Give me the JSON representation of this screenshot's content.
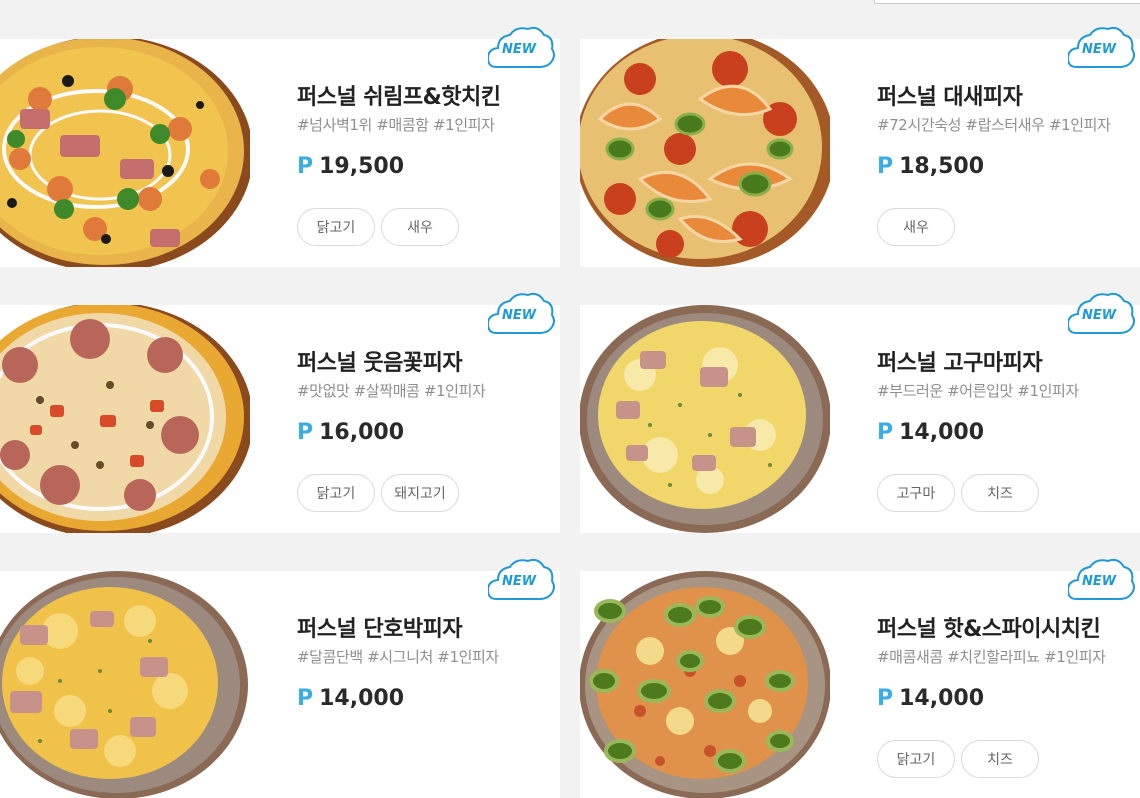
{
  "accent_color": "#3aaee4",
  "badge_color": "#1f9ad6",
  "products": [
    {
      "name": "퍼스널 쉬림프&핫치킨",
      "tags": "#넘사벽1위 #매콤함 #1인피자",
      "currency": "P",
      "price": "19,500",
      "badge": "NEW",
      "image": "shrimp-hot-chicken-pizza",
      "toppings": [
        "닭고기",
        "새우"
      ]
    },
    {
      "name": "퍼스널 대새피자",
      "tags": "#72시간숙성 #랍스터새우 #1인피자",
      "currency": "P",
      "price": "18,500",
      "badge": "NEW",
      "image": "big-shrimp-pizza",
      "toppings": [
        "새우"
      ]
    },
    {
      "name": "퍼스널 웃음꽃피자",
      "tags": "#맛없맛 #살짝매콤 #1인피자",
      "currency": "P",
      "price": "16,000",
      "badge": "NEW",
      "image": "smile-flower-pizza",
      "toppings": [
        "닭고기",
        "돼지고기"
      ]
    },
    {
      "name": "퍼스널 고구마피자",
      "tags": "#부드러운 #어른입맛 #1인피자",
      "currency": "P",
      "price": "14,000",
      "badge": "NEW",
      "image": "sweet-potato-pizza",
      "toppings": [
        "고구마",
        "치즈"
      ]
    },
    {
      "name": "퍼스널 단호박피자",
      "tags": "#달콤단백 #시그니처 #1인피자",
      "currency": "P",
      "price": "14,000",
      "badge": "NEW",
      "image": "sweet-pumpkin-pizza",
      "toppings": []
    },
    {
      "name": "퍼스널 핫&스파이시치킨",
      "tags": "#매콤새콤 #치킨할라피뇨 #1인피자",
      "currency": "P",
      "price": "14,000",
      "badge": "NEW",
      "image": "hot-spicy-chicken-pizza",
      "toppings": [
        "닭고기",
        "치즈"
      ]
    }
  ]
}
